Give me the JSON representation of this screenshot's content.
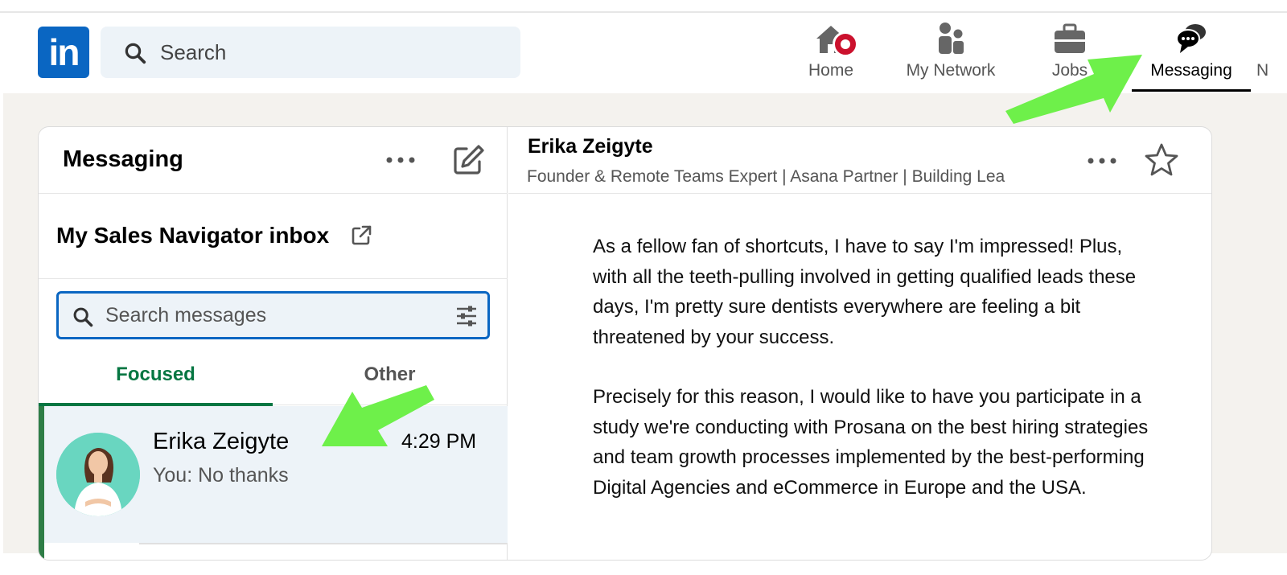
{
  "nav": {
    "logo_text": "in",
    "search_placeholder": "Search",
    "items": [
      {
        "label": "Home",
        "icon": "home-icon"
      },
      {
        "label": "My Network",
        "icon": "network-icon"
      },
      {
        "label": "Jobs",
        "icon": "briefcase-icon"
      },
      {
        "label": "Messaging",
        "icon": "messaging-icon"
      }
    ],
    "more_label_partial": "N"
  },
  "left_pane": {
    "title": "Messaging",
    "sales_navigator_label": "My Sales Navigator inbox",
    "search_placeholder": "Search messages",
    "tabs": [
      {
        "label": "Focused",
        "active": true
      },
      {
        "label": "Other",
        "active": false
      }
    ],
    "conversations": [
      {
        "name": "Erika Zeigyte",
        "time": "4:29 PM",
        "preview": "You: No thanks"
      }
    ]
  },
  "right_pane": {
    "contact_name": "Erika Zeigyte",
    "contact_headline": "Founder & Remote Teams Expert | Asana Partner | Building Lea",
    "message_paragraphs": [
      "As a fellow fan of shortcuts, I have to say I'm impressed! Plus, with all the teeth-pulling involved in getting qualified leads these days, I'm pretty sure dentists everywhere are feeling a bit threatened by your success.",
      "Precisely for this reason, I would like to have you participate in a study we're conducting with Prosana on the best hiring strategies and team growth processes implemented by the best-performing Digital Agencies and eCommerce in Europe and the USA."
    ]
  },
  "colors": {
    "brand": "#0a66c2",
    "focused_green": "#057642",
    "badge_red": "#cb112d",
    "annotation_arrow": "#6ef04a",
    "page_bg": "#f4f2ee"
  }
}
